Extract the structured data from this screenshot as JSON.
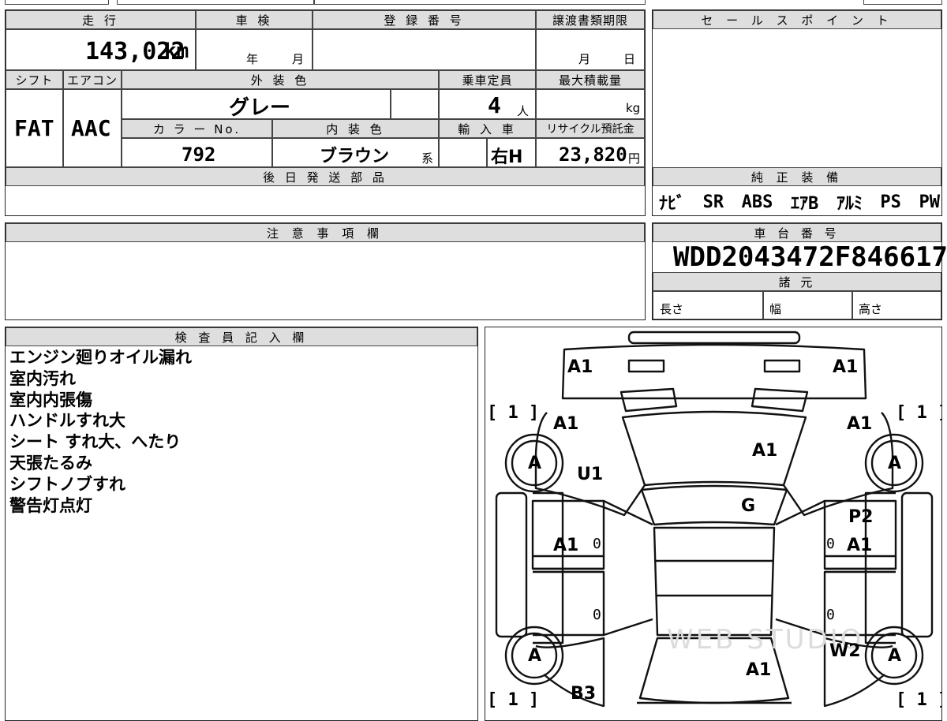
{
  "top_strip": [
    "",
    "",
    "",
    ""
  ],
  "spec": {
    "h_mileage": "走 行",
    "h_inspection": "車 検",
    "h_registration": "登 録 番 号",
    "h_transfer": "譲渡書類期限",
    "mileage": "143,022",
    "mileage_unit": "km",
    "insp_year": "年",
    "insp_month": "月",
    "transfer_month": "月",
    "transfer_day": "日",
    "h_shift": "シフト",
    "h_ac": "エアコン",
    "h_exterior": "外 装 色",
    "h_capacity": "乗車定員",
    "h_maxload": "最大積載量",
    "shift": "FAT",
    "ac": "AAC",
    "exterior_color": "グレー",
    "capacity": "4",
    "capacity_unit": "人",
    "load_unit": "kg",
    "h_color_no": "カ ラ ー No.",
    "h_interior": "内 装 色",
    "h_import": "輸 入 車",
    "h_recycle": "リサイクル預託金",
    "color_no": "792",
    "interior_color": "ブラウン",
    "interior_suffix": "系",
    "import": "右H",
    "recycle": "23,820",
    "recycle_unit": "円",
    "h_later_parts": "後 日 発 送 部 品"
  },
  "sale": {
    "h_sale": "セ ー ル ス ポ イ ン ト",
    "h_equipment": "純 正 装 備",
    "equipment": [
      "ﾅﾋﾞ",
      "SR",
      "ABS",
      "ｴｱB",
      "ｱﾙﾐ",
      "PS",
      "PW"
    ]
  },
  "notes": {
    "h_notes": "注 意 事 項 欄"
  },
  "chassis": {
    "h_chassis": "車 台 番 号",
    "vin": "WDD2043472F846617",
    "h_specs": "諸 元",
    "length": "長さ",
    "width": "幅",
    "height": "高さ"
  },
  "inspector": {
    "h_inspector": "検 査 員 記 入 欄",
    "lines": [
      "エンジン廻りオイル漏れ",
      "室内汚れ",
      "室内内張傷",
      "ハンドルすれ大",
      "シート すれ大、へたり",
      "天張たるみ",
      "シフトノブすれ",
      "警告灯点灯"
    ]
  },
  "diagram": {
    "marks": {
      "a1_front_left": "A1",
      "a1_front_right": "A1",
      "a1_fender_left": "A1",
      "a1_fender_right": "A1",
      "a1_hood": "A1",
      "u1": "U1",
      "g": "G",
      "p2": "P2",
      "a1_door_left": "A1",
      "a1_door_right": "A1",
      "w2": "W2",
      "a1_trunk": "A1",
      "b3": "B3"
    },
    "tires": [
      "A",
      "A",
      "A",
      "A"
    ],
    "brackets": [
      "[ 1 ]",
      "[ 1 ]",
      "[ 1 ]",
      "[ 1 ]"
    ],
    "zeros": [
      "0",
      "0",
      "0",
      "0"
    ],
    "watermark": "WEB STUDIO"
  }
}
